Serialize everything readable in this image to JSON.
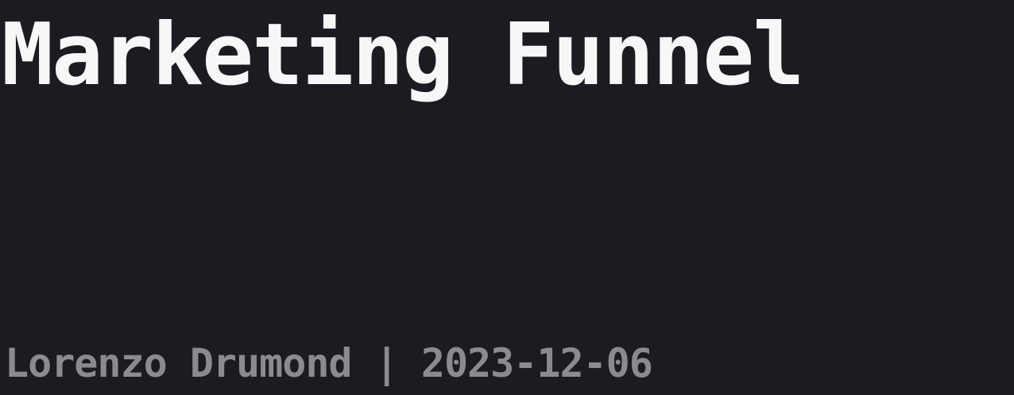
{
  "slide": {
    "title": "Marketing Funnel",
    "byline": "Lorenzo Drumond | 2023-12-06"
  },
  "colors": {
    "background": "#1b1c21",
    "title": "#f7f7f7",
    "byline": "#8b8b8f"
  }
}
